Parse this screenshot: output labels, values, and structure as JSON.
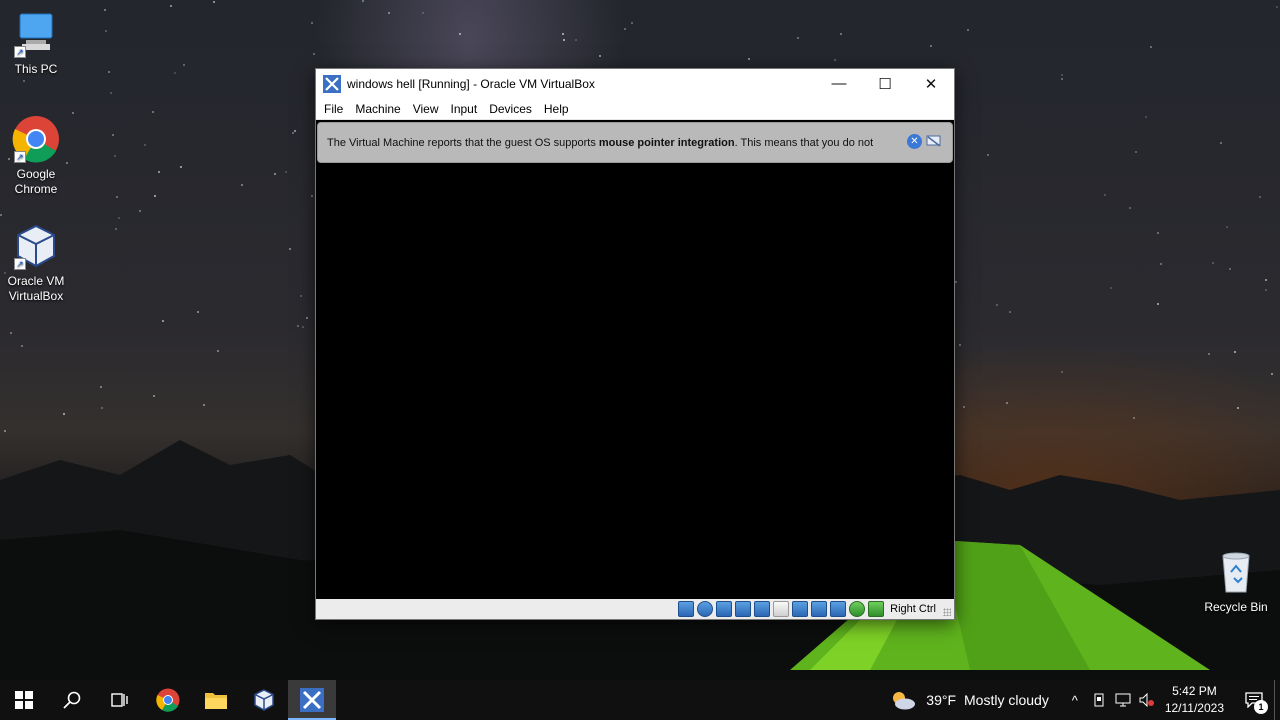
{
  "desktop": {
    "icons": [
      {
        "label": "This PC",
        "icon": "computer-icon"
      },
      {
        "label": "Google Chrome",
        "icon": "chrome-icon"
      },
      {
        "label": "Oracle VM VirtualBox",
        "icon": "virtualbox-icon"
      },
      {
        "label": "Recycle Bin",
        "icon": "recycle-bin-icon"
      }
    ]
  },
  "window": {
    "title": "windows hell [Running] - Oracle VM VirtualBox",
    "controls": {
      "minimize": "—",
      "maximize": "☐",
      "close": "✕"
    },
    "menu": [
      "File",
      "Machine",
      "View",
      "Input",
      "Devices",
      "Help"
    ],
    "notice": {
      "prefix": "The Virtual Machine reports that the guest OS supports ",
      "bold": "mouse pointer integration",
      "suffix": ". This means that you do not"
    },
    "statusbar": {
      "host_key": "Right Ctrl",
      "icons": [
        "hard-disk-icon",
        "optical-drive-icon",
        "audio-icon",
        "network-icon",
        "usb-icon",
        "shared-folders-icon",
        "display-icon",
        "video-capture-icon",
        "virtualization-icon",
        "mouse-integration-icon",
        "keyboard-icon"
      ]
    }
  },
  "taskbar": {
    "apps": [
      "start-icon",
      "search-icon",
      "task-view-icon",
      "chrome-icon",
      "file-explorer-icon",
      "virtualbox-icon",
      "vm-windows-xp-icon"
    ],
    "weather": {
      "temp": "39°F",
      "condition": "Mostly cloudy"
    },
    "clock": {
      "time": "5:42 PM",
      "date": "12/11/2023"
    },
    "notification_count": "1"
  },
  "colors": {
    "accent": "#7cb6ff",
    "notice_bg": "#b9b9b9",
    "taskbar_bg": "#101010"
  }
}
